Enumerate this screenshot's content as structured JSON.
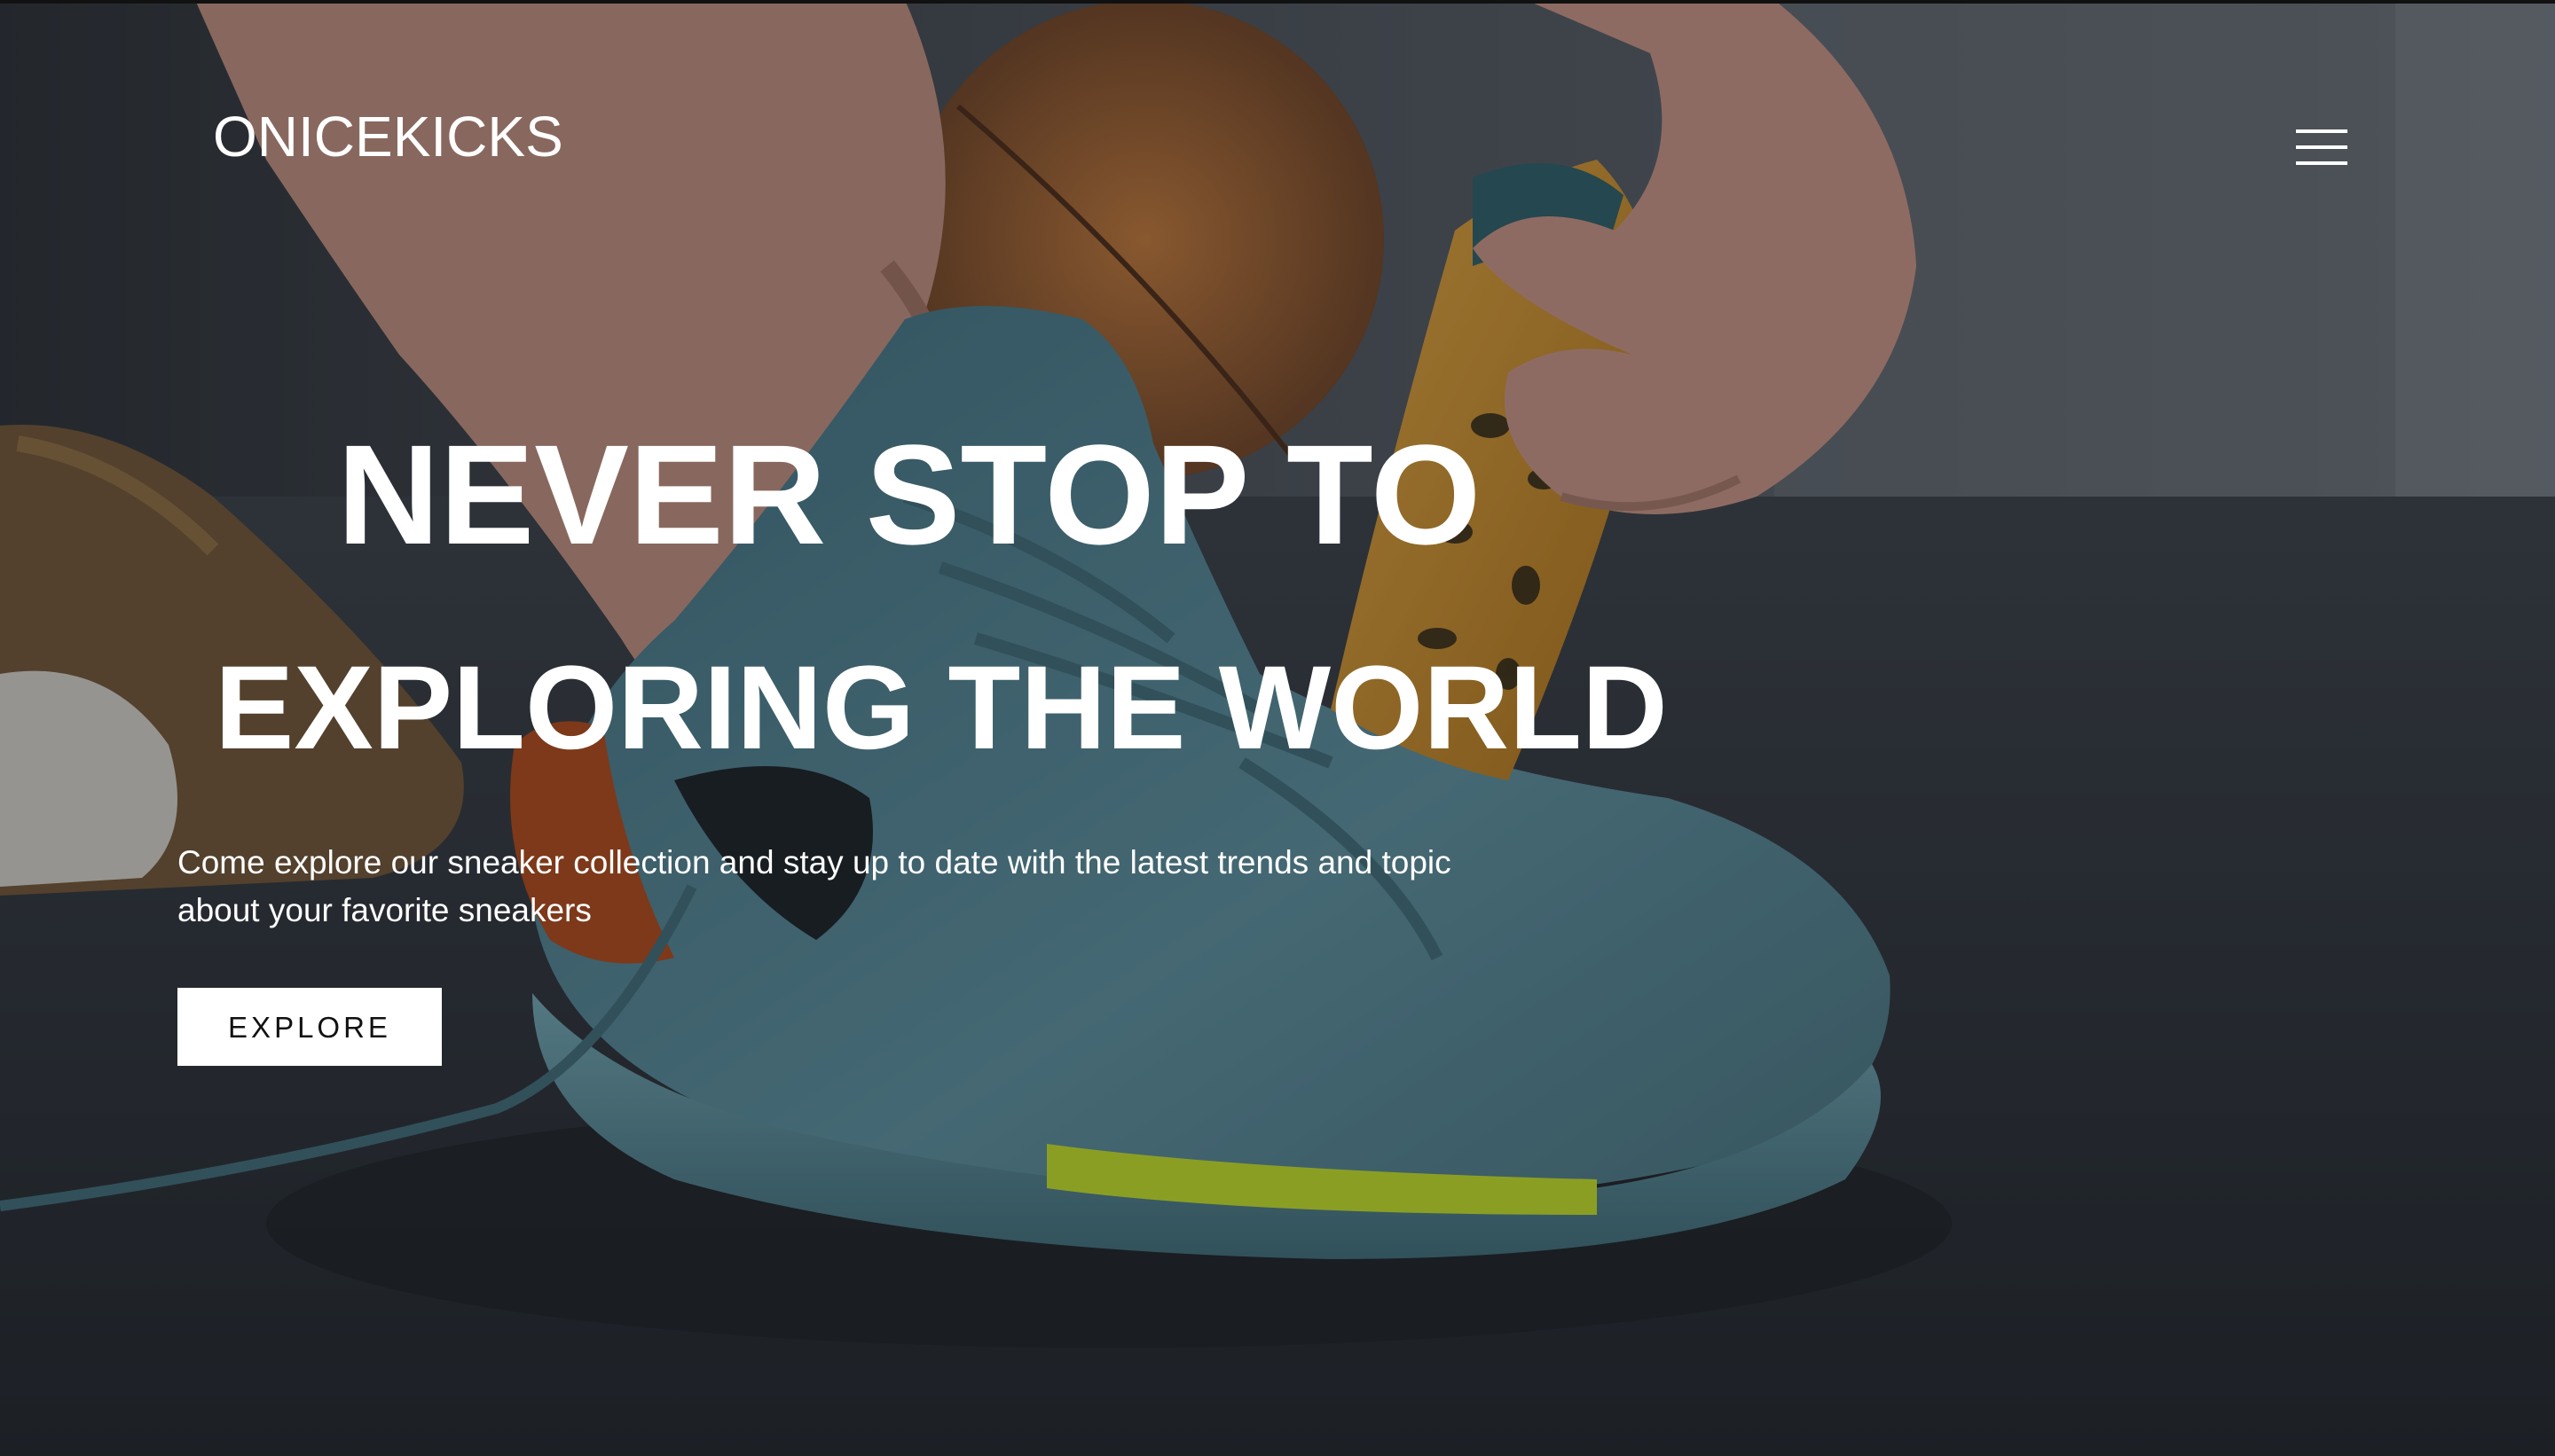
{
  "header": {
    "logo": "ONICEKICKS",
    "menu_icon": "hamburger-menu-icon"
  },
  "hero": {
    "headline_line1": "NEVER STOP TO",
    "headline_line2": "EXPLORING THE WORLD",
    "subtitle": "Come explore our sneaker collection and stay up to date with the latest trends and topic about your favorite sneakers",
    "cta_label": "EXPLORE"
  },
  "background": {
    "description_icon": "sneaker-lacing-photo",
    "colors": {
      "floor": "#2b3038",
      "wall": "#4a5058",
      "shoe": "#4e7d8c",
      "shoe_sole": "#6b9aa6",
      "accent_yellow": "#c8e030",
      "tongue_orange": "#c98b2a",
      "skin": "#c9998a"
    }
  }
}
